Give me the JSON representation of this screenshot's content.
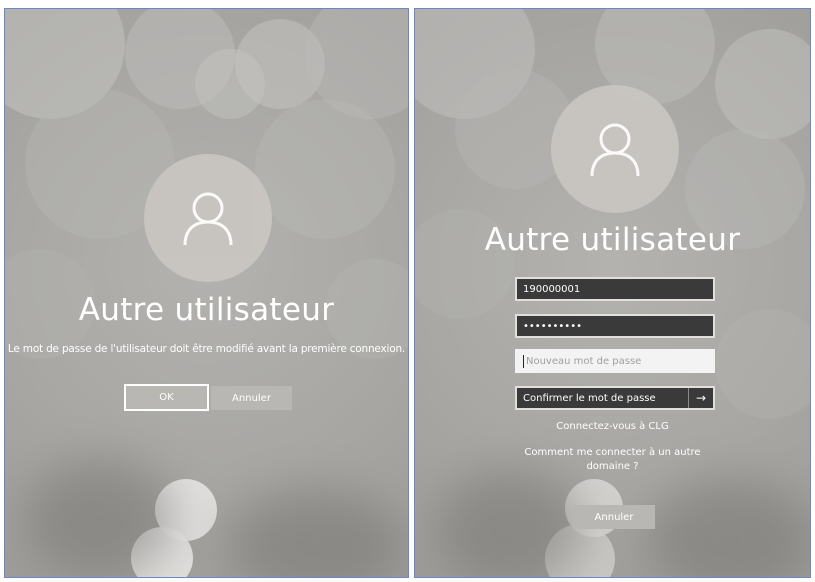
{
  "left": {
    "title": "Autre utilisateur",
    "message": "Le mot de passe de l'utilisateur doit être modifié avant la première connexion.",
    "ok_label": "OK",
    "cancel_label": "Annuler"
  },
  "right": {
    "title": "Autre utilisateur",
    "username_value": "190000001",
    "password_value": "••••••••••",
    "new_password_placeholder": "Nouveau mot de passe",
    "confirm_password_placeholder": "Confirmer le mot de passe",
    "connect_link": "Connectez-vous à CLG",
    "other_domain_link_line1": "Comment me connecter à un autre",
    "other_domain_link_line2": "domaine ?",
    "cancel_label": "Annuler"
  },
  "icons": {
    "avatar": "user-icon",
    "submit": "arrow-right-icon"
  },
  "colors": {
    "background": "#a8a7a4",
    "field_dark": "#3a3a3a",
    "panel_border": "#6b87c9"
  }
}
